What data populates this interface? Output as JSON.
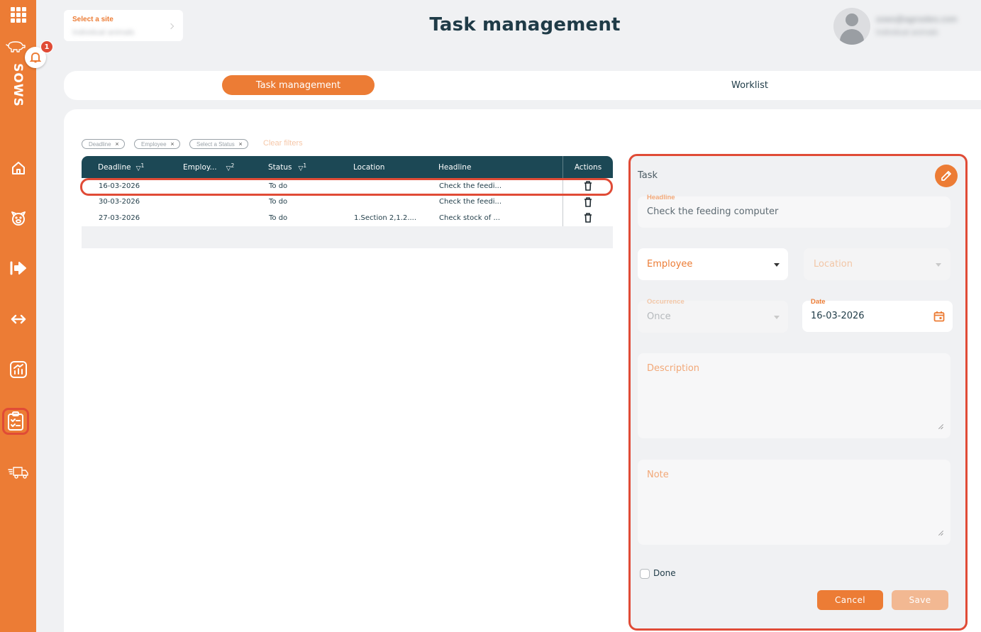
{
  "app": {
    "brand": "SOWS",
    "notification_count": "1"
  },
  "sidebar": {
    "items": [
      {
        "name": "apps-grid-icon"
      },
      {
        "name": "pig-icon"
      },
      {
        "name": "home-icon"
      },
      {
        "name": "piglet-icon"
      },
      {
        "name": "move-in-icon"
      },
      {
        "name": "transfer-icon"
      },
      {
        "name": "analytics-icon"
      },
      {
        "name": "tasks-icon",
        "active": true
      },
      {
        "name": "delivery-truck-icon"
      }
    ],
    "accent_color": "#ec7c35"
  },
  "header": {
    "site_label": "Select a site",
    "site_value": "Individual animals",
    "title": "Task management",
    "user_email": "sows@agrosites.com",
    "user_sub": "Individual animals"
  },
  "tabs": [
    {
      "label": "Task management",
      "active": true
    },
    {
      "label": "Worklist",
      "active": false
    }
  ],
  "filters": {
    "chips": [
      "Deadline",
      "Employee",
      "Select a Status"
    ],
    "clear_label": "Clear filters"
  },
  "table": {
    "columns": [
      {
        "label": "Deadline",
        "sort": "1"
      },
      {
        "label": "Employ...",
        "sort": "2"
      },
      {
        "label": "Status",
        "sort": "1"
      },
      {
        "label": "Location"
      },
      {
        "label": "Headline"
      },
      {
        "label": "Actions"
      }
    ],
    "rows": [
      {
        "deadline": "16-03-2026",
        "employee": "",
        "status": "To do",
        "location": "",
        "headline": "Check the feedi...",
        "selected": true
      },
      {
        "deadline": "30-03-2026",
        "employee": "",
        "status": "To do",
        "location": "",
        "headline": "Check the feedi..."
      },
      {
        "deadline": "27-03-2026",
        "employee": "",
        "status": "To do",
        "location": "1.Section 2,1.2....",
        "headline": "Check stock of ..."
      }
    ]
  },
  "task_form": {
    "title": "Task",
    "headline": {
      "label": "Headline",
      "value": "Check the feeding computer"
    },
    "employee": {
      "placeholder": "Employee"
    },
    "location": {
      "placeholder": "Location"
    },
    "occurrence": {
      "label": "Occurrence",
      "value": "Once"
    },
    "date": {
      "label": "Date",
      "value": "16-03-2026"
    },
    "description": {
      "placeholder": "Description"
    },
    "note": {
      "placeholder": "Note"
    },
    "done_label": "Done",
    "done_checked": false,
    "cancel_label": "Cancel",
    "save_label": "Save"
  },
  "colors": {
    "accent": "#ec7c35",
    "header_dark": "#1c4855",
    "highlight": "#e04b36",
    "background": "#f0f1f3"
  }
}
